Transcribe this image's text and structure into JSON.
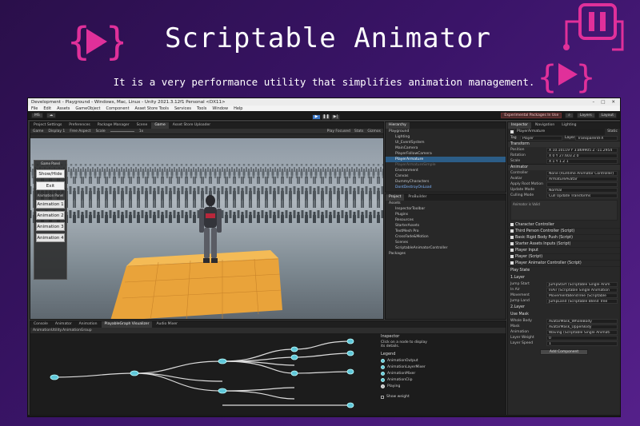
{
  "banner": {
    "title": "Scriptable Animator",
    "subtitle": "It is a very performance utility that simplifies animation management."
  },
  "colors": {
    "accent_magenta": "#e0309a",
    "bg_purple": "#3a1468",
    "selection_blue": "#2c5d87",
    "node_cyan": "#5fc7d9"
  },
  "window": {
    "title": "Development - Playground - Windows, Mac, Linux - Unity 2021.3.12f1 Personal <DX11>",
    "menu": [
      "File",
      "Edit",
      "Assets",
      "GameObject",
      "Component",
      "Asset Store Tools",
      "Services",
      "Tools",
      "Window",
      "Help"
    ]
  },
  "toolbar": {
    "account": "MS",
    "warning": "Experimental Packages In Use",
    "layers": "Layers",
    "layout": "Layout"
  },
  "game_view": {
    "tabs": [
      "Project Settings",
      "Preferences",
      "Package Manager",
      "Scene",
      "Game",
      "Asset Store Uploader"
    ],
    "display": "Game",
    "display_num": "Display 1",
    "aspect": "Free Aspect",
    "scale": "Scale",
    "scale_value": "1x",
    "play_mode": "Play Focused",
    "stats": "Stats",
    "gizmos": "Gizmos",
    "game_panel": {
      "title": "Game Panel",
      "show_hide": "Show/Hide",
      "exit": "Exit",
      "animations_label": "Animation Panel",
      "animations": [
        "Animation 1",
        "Animation 2",
        "Animation 3",
        "Animation 4"
      ]
    }
  },
  "hierarchy": {
    "tab": "Hierarchy",
    "rows": [
      {
        "label": "Playground",
        "style": "root"
      },
      {
        "label": "Lighting",
        "style": ""
      },
      {
        "label": "UI_EventSystem",
        "style": ""
      },
      {
        "label": "MainCamera",
        "style": ""
      },
      {
        "label": "PlayerFollowCamera",
        "style": ""
      },
      {
        "label": "PlayerArmature",
        "style": "sel"
      },
      {
        "label": "PlayerArmatureSimple",
        "style": "dim"
      },
      {
        "label": "Environment",
        "style": ""
      },
      {
        "label": "Canvas",
        "style": ""
      },
      {
        "label": "DummyCharacters",
        "style": ""
      },
      {
        "label": "DontDestroyOnLoad",
        "style": "blue"
      }
    ]
  },
  "project": {
    "tabs": [
      "Project",
      "ProBuilder"
    ],
    "rows": [
      {
        "label": "Assets",
        "style": "root"
      },
      {
        "label": "InspectorToolbar",
        "style": ""
      },
      {
        "label": "Plugins",
        "style": ""
      },
      {
        "label": "Resources",
        "style": ""
      },
      {
        "label": "StarterAssets",
        "style": ""
      },
      {
        "label": "TextMesh Pro",
        "style": ""
      },
      {
        "label": "CrossFade&Motion",
        "style": ""
      },
      {
        "label": "Scenes",
        "style": ""
      },
      {
        "label": "ScriptableAnimatorController",
        "style": ""
      },
      {
        "label": "Packages",
        "style": "root"
      }
    ]
  },
  "inspector": {
    "tabs": [
      "Inspector",
      "Navigation",
      "Lighting"
    ],
    "object_name": "PlayerArmature",
    "static_label": "Static",
    "tag_label": "Tag",
    "tag": "Player",
    "layer_label": "Layer",
    "layer": "TransparentFX",
    "transform_title": "Transform",
    "transform_rows": [
      {
        "k": "Position",
        "v": "X 10.10119   Y 3.869905   Z -11.2954"
      },
      {
        "k": "Rotation",
        "v": "X 0   Y 27.603   Z 0"
      },
      {
        "k": "Scale",
        "v": "X 1   Y 1   Z 1"
      }
    ],
    "animator_title": "Animator",
    "animator_rows": [
      {
        "k": "Controller",
        "v": "None (Runtime Animator Controller)"
      },
      {
        "k": "Avatar",
        "v": "ArmatureAvatar"
      },
      {
        "k": "Apply Root Motion",
        "v": ""
      },
      {
        "k": "Update Mode",
        "v": "Normal"
      },
      {
        "k": "Culling Mode",
        "v": "Cull Update Transforms"
      }
    ],
    "animator_info": "Animator is Valid",
    "components": [
      "Character Controller",
      "Third Person Controller (Script)",
      "Basic Rigid Body Push (Script)",
      "Starter Assets Inputs (Script)",
      "Player Input",
      "Player (Script)",
      "Player Animator Controller (Script)"
    ],
    "play_state_label": "Play State",
    "layer1_title": "1.Layer",
    "layer1_rows": [
      {
        "k": "Jump Start",
        "v": "JumpStart (Scriptable Single Anim"
      },
      {
        "k": "In Air",
        "v": "InAir (Scriptable Single Animation"
      },
      {
        "k": "Movement",
        "v": "MovementBlendTree (Scriptable"
      },
      {
        "k": "Jump Land",
        "v": "JumpLand (Scriptable Blend Tree"
      }
    ],
    "layer2_title": "2.Layer",
    "use_mask": "Use Mask",
    "layer2_rows": [
      {
        "k": "Whole Body",
        "v": "AvatarMask_WholeBody"
      },
      {
        "k": "Mask",
        "v": "AvatarMask_UpperBody"
      },
      {
        "k": "Animation",
        "v": "Waving (Scriptable Single Animati"
      },
      {
        "k": "Layer Weight",
        "v": "0"
      },
      {
        "k": "Layer Speed",
        "v": "1"
      }
    ],
    "add_component": "Add Component"
  },
  "graph": {
    "tabs": [
      "Console",
      "Animator",
      "Animation",
      "PlayableGraph Visualizer",
      "Audio Mixer"
    ],
    "selector": "AnimationUtility.AnimationGroup",
    "inspector_title": "Inspector",
    "inspector_hint": "Click on a node to display its details.",
    "legend_title": "Legend",
    "legend": [
      "AnimationOutput",
      "AnimationLayerMixer",
      "AnimationMixer",
      "AnimationClip",
      "Playing"
    ],
    "show_weight": "Show weight"
  }
}
